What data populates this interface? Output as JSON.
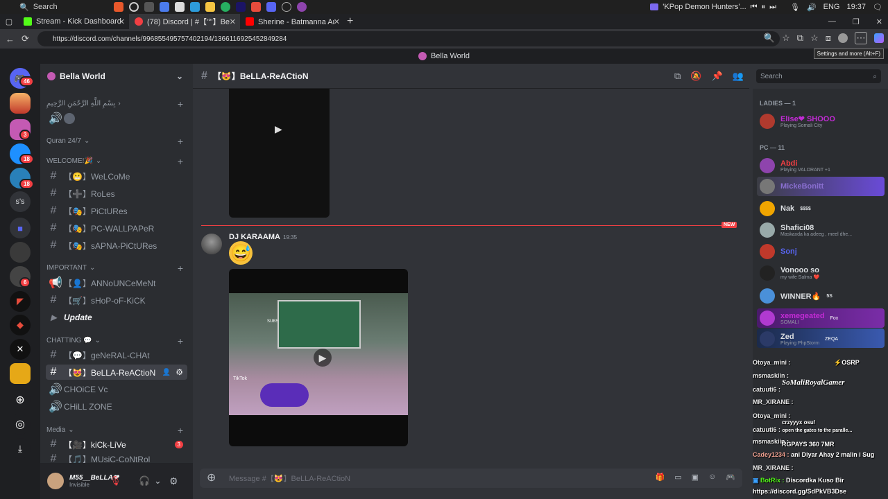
{
  "os_taskbar": {
    "search_label": "Search",
    "media_title": "'KPop Demon Hunters'...",
    "language": "ENG",
    "clock": "19:37"
  },
  "browser": {
    "tabs": [
      {
        "title": "Stream - Kick Dashboard",
        "favicon_color": "#53fc18"
      },
      {
        "title": "(78) Discord | #【'°'】BeLLA-ReAC",
        "favicon_color": "#f23f43"
      },
      {
        "title": "Sherine - Batmanna Ansak | شيرين",
        "favicon_color": "#ff0000"
      }
    ],
    "url": "https://discord.com/channels/996855495757402194/1366116925452849284",
    "tooltip": "Settings and more (Alt+F)"
  },
  "discord": {
    "window_title": "Bella World",
    "server_name": "Bella World",
    "guild_badges": [
      "46",
      "3",
      "18",
      "18",
      "6"
    ],
    "guild_label_ss": "s's",
    "categories": {
      "top_label": "بِسْمِ اللَّهِ الرَّحْمَنِ الرَّحِيمِ",
      "quran": "Quran 24/7",
      "welcome": "WELCOME!🎉",
      "important": "IMPORTANT",
      "chatting": "CHATTING 💬",
      "media": "Media"
    },
    "channels": {
      "welcome": "【😬】WeLCoMe",
      "roles": "【➕】RoLes",
      "pictures": "【🎭】PiCtURes",
      "pc_wallpaper": "【🎭】PC-WALLPAPeR",
      "sapna": "【🎭】sAPNA-PiCtURes",
      "announcement": "【👤】ANNoUNCeMeNt",
      "shop": "【🛒】sHoP-oF-KiCK",
      "update": "Update",
      "general": "【💬】geNeRAL-CHAt",
      "bella_reaction": "【😻】BeLLA-ReACtioN",
      "choice_vc": "CHOiCE Vc",
      "chill_zone": "CHiLL ZONE",
      "kick_live": "【🎥】kiCk-LiVe",
      "music_control": "【🎵】MUsiC-CoNtRol"
    },
    "unread_kick_live": "3",
    "user": {
      "name": "M55__BeLLA❤",
      "status": "Invisible"
    },
    "chat": {
      "channel_title": "【😻】BeLLA-ReACtioN",
      "search_placeholder": "Search",
      "new_label": "NEW",
      "author": "DJ KARAAMA",
      "timestamp": "19:35",
      "video_subs": "SUBS: 11/20",
      "video_brand": "TikTok",
      "composer_placeholder": "Message #【😻】BeLLA-ReACtioN"
    },
    "members": {
      "ladies_header": "LADIES — 1",
      "pc_header": "PC — 11",
      "list": [
        {
          "name": "Elise❤ SHOOO",
          "activity": "Playing Somali City",
          "color": "#c22bd4"
        },
        {
          "name": "Abdi",
          "activity": "Playing VALORANT +1",
          "color": "#f23f43"
        },
        {
          "name": "MickeBonitt",
          "activity": "",
          "color": "#8a6fd1"
        },
        {
          "name": "Nak",
          "activity": "",
          "tag": "$$$$",
          "color": "#dbdee1"
        },
        {
          "name": "Shafici08",
          "activity": "Maskaxda ka adeeg , meel dhe...",
          "color": "#dbdee1"
        },
        {
          "name": "Sonj",
          "activity": "",
          "color": "#5865f2"
        },
        {
          "name": "Vonooo so",
          "activity": "my wife Salma ❤️",
          "color": "#dbdee1"
        },
        {
          "name": "WINNER🔥",
          "activity": "",
          "tag": "5S",
          "color": "#dbdee1"
        },
        {
          "name": "xemegeated",
          "activity": "SOMALI",
          "tag": "Fox",
          "color": "#c22bd4"
        },
        {
          "name": "Zed",
          "activity": "Playing PhpStorm",
          "tag": "ZEQA",
          "color": "#dbdee1"
        }
      ]
    }
  },
  "stream_overlay": {
    "lines": [
      {
        "user": "Otoya_mini :",
        "text": "⚡OSRP"
      },
      {
        "user": "msmaskiin :",
        "text": "SoMaliRoyalGamer"
      },
      {
        "user": "catuuti6 :",
        "text": ""
      },
      {
        "user": "MR_XIRANE :",
        "text": ""
      },
      {
        "user": "Otoya_mini :",
        "text": "crzyyyx osu!"
      },
      {
        "user": "catuuti6 :",
        "text": "open the gates to the paralle..."
      },
      {
        "user": "msmaskiin :",
        "text": "RGPAYS 360 7MR"
      },
      {
        "user": "Cadey1234 :",
        "text": "ani Diyar Ahay 2 malin i Sug"
      },
      {
        "user": "MR_XIRANE :",
        "text": ""
      },
      {
        "user": "BotRix :",
        "text": "Discordka Kuso Bir"
      },
      {
        "user": "",
        "text": "https://discord.gg/SdPkVB3Dse"
      }
    ]
  }
}
